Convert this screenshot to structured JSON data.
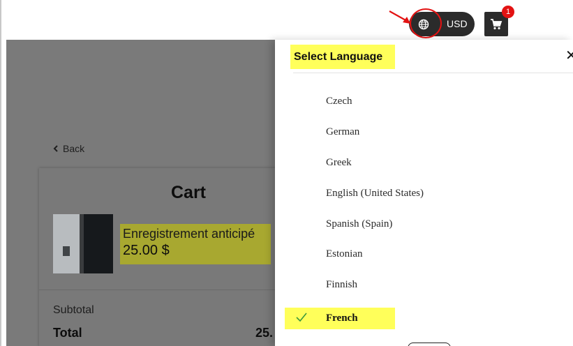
{
  "header": {
    "currency": "USD",
    "cart_count": "1",
    "icons": {
      "language": "globe-icon",
      "cart": "cart-icon"
    }
  },
  "back": {
    "label": "Back",
    "icon": "chevron-left-icon"
  },
  "cart": {
    "title": "Cart",
    "item": {
      "name": "Enregistrement anticipé",
      "price": "25.00 $"
    },
    "subtotal_label": "Subtotal",
    "total_label": "Total",
    "total_value": "25."
  },
  "language_panel": {
    "title": "Select Language",
    "close_label": "✕",
    "languages": [
      {
        "label": "Czech",
        "selected": false
      },
      {
        "label": "German",
        "selected": false
      },
      {
        "label": "Greek",
        "selected": false
      },
      {
        "label": "English (United States)",
        "selected": false
      },
      {
        "label": "Spanish (Spain)",
        "selected": false
      },
      {
        "label": "Estonian",
        "selected": false
      },
      {
        "label": "Finnish",
        "selected": false
      },
      {
        "label": "French",
        "selected": true
      }
    ]
  },
  "colors": {
    "highlight": "#ffff5a",
    "dark_button": "#2b2b2b",
    "badge": "#e31212",
    "check": "#3c9a3c"
  }
}
